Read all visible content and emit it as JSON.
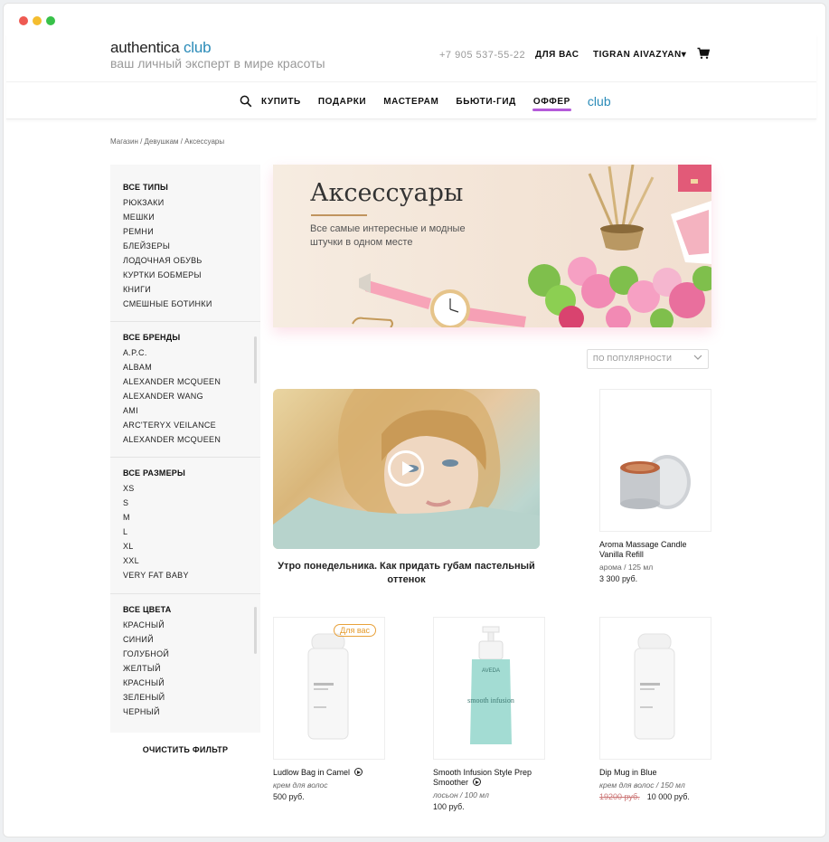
{
  "window": {
    "controls": [
      "close",
      "minimize",
      "maximize"
    ]
  },
  "header": {
    "logo_main": "authentica",
    "logo_club": "club",
    "tagline": "ваш личный эксперт в мире красоты",
    "phone": "+7 905 537-55-22",
    "for_you": "ДЛЯ ВАС",
    "user_name": "TIGRAN AIVAZYAN",
    "user_caret": "▾"
  },
  "nav": {
    "items": [
      {
        "label": "КУПИТЬ"
      },
      {
        "label": "ПОДАРКИ"
      },
      {
        "label": "МАСТЕРАМ"
      },
      {
        "label": "БЬЮТИ-ГИД"
      },
      {
        "label": "ОФФЕР"
      }
    ],
    "club": "club",
    "accent_color": "#b45ad9"
  },
  "breadcrumb": "Магазин / Девушкам / Аксессуары",
  "filters": {
    "types": {
      "title": "ВСЕ ТИПЫ",
      "options": [
        "РЮКЗАКИ",
        "МЕШКИ",
        "РЕМНИ",
        "БЛЕЙЗЕРЫ",
        "ЛОДОЧНАЯ ОБУВЬ",
        "КУРТКИ БОБМЕРЫ",
        "КНИГИ",
        "СМЕШНЫЕ БОТИНКИ"
      ]
    },
    "brands": {
      "title": "ВСЕ БРЕНДЫ",
      "options": [
        "A.P.C.",
        "ALBAM",
        "ALEXANDER MCQUEEN",
        "ALEXANDER WANG",
        "AMI",
        "ARC'TERYX VEILANCE",
        "ALEXANDER MCQUEEN"
      ]
    },
    "sizes": {
      "title": "ВСЕ РАЗМЕРЫ",
      "options": [
        "XS",
        "S",
        "M",
        "L",
        "XL",
        "XXL",
        "VERY FAT BABY"
      ]
    },
    "colors": {
      "title": "ВСЕ ЦВЕТА",
      "options": [
        "КРАСНЫЙ",
        "СИНИЙ",
        "ГОЛУБНОЙ",
        "ЖЕЛТЫЙ",
        "КРАСНЫЙ",
        "ЗЕЛЕНЫЙ",
        "ЧЕРНЫЙ"
      ]
    },
    "clear": "ОЧИСТИТЬ ФИЛЬТР"
  },
  "banner": {
    "title": "Аксессуары",
    "text": "Все самые интересные и модные штучки в одном месте"
  },
  "sort": {
    "selected": "ПО ПОПУЛЯРНОСТИ"
  },
  "video": {
    "title": "Утро понедельника. Как придать губам пастельный оттенок"
  },
  "products": [
    {
      "name": "Aroma Massage Candle Vanilla Refill",
      "sub": "арома / 125 мл",
      "price": "3 300 руб."
    },
    {
      "name": "Ludlow Bag in Camel",
      "sub": "крем для волос",
      "price": "500 руб.",
      "badge": "Для вас",
      "has_play": true
    },
    {
      "name": "Smooth Infusion Style Prep Smoother",
      "sub": "лосьон / 100 мл",
      "price": "100 руб.",
      "has_play": true,
      "brand": "AVEDA",
      "label": "smooth infusion"
    },
    {
      "name": "Dip Mug in Blue",
      "sub": "крем для волос / 150 мл",
      "old_price": "19200 руб.",
      "price": "10 000 руб."
    }
  ]
}
